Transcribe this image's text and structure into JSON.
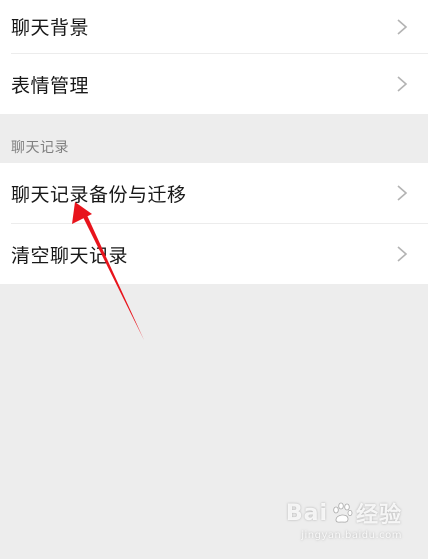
{
  "settings": {
    "items_top": [
      {
        "label": "聊天背景"
      },
      {
        "label": "表情管理"
      }
    ],
    "section_label": "聊天记录",
    "items_history": [
      {
        "label": "聊天记录备份与迁移"
      },
      {
        "label": "清空聊天记录"
      }
    ],
    "chevron_icon": "chevron-right-icon"
  },
  "annotation": {
    "arrow_color": "#e8141c",
    "points_to": "聊天记录备份与迁移"
  },
  "watermark": {
    "logo_text": "Bai",
    "logo_suffix": "经验",
    "sub_text": "jingyan.baidu.com"
  }
}
